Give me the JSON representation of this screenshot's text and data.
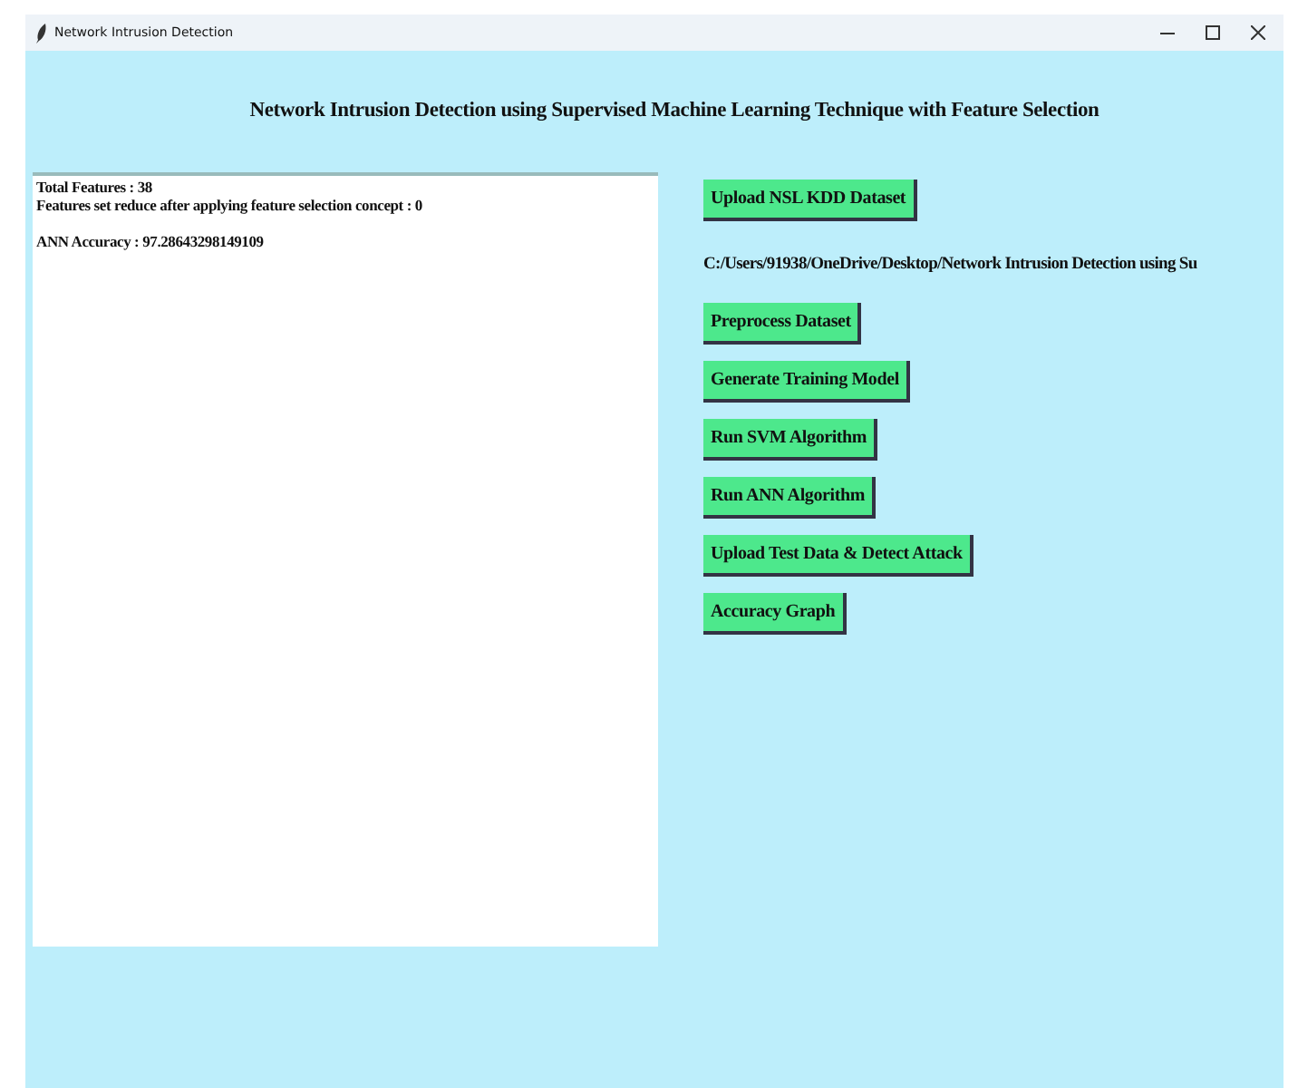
{
  "window": {
    "title": "Network Intrusion Detection"
  },
  "heading": "Network Intrusion Detection using Supervised Machine Learning Technique with Feature Selection",
  "output_blocks": [
    [
      "Total Features : 38",
      "Features set reduce after applying feature selection concept : 0"
    ],
    [
      "ANN Accuracy : 97.28643298149109"
    ]
  ],
  "upload_button": "Upload NSL KDD Dataset",
  "path_label": "C:/Users/91938/OneDrive/Desktop/Network Intrusion Detection using Su",
  "buttons": [
    "Preprocess Dataset",
    "Generate Training Model",
    "Run SVM Algorithm",
    "Run ANN Algorithm",
    "Upload Test Data & Detect Attack",
    "Accuracy Graph"
  ]
}
